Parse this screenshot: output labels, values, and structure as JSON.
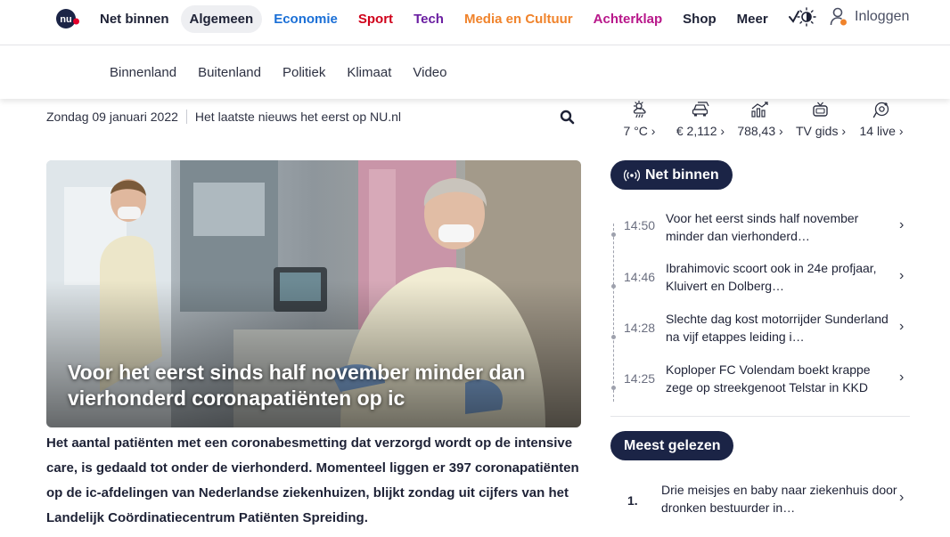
{
  "header": {
    "logo_alt": "NU.nl",
    "nav": [
      {
        "label": "Net binnen",
        "color": "#1e2236",
        "active": false
      },
      {
        "label": "Algemeen",
        "color": "#1e2236",
        "active": true
      },
      {
        "label": "Economie",
        "color": "#1a6fd6",
        "active": false
      },
      {
        "label": "Sport",
        "color": "#d0021b",
        "active": false
      },
      {
        "label": "Tech",
        "color": "#6a1ea1",
        "active": false
      },
      {
        "label": "Media en Cultuur",
        "color": "#f0832b",
        "active": false
      },
      {
        "label": "Achterklap",
        "color": "#b8178a",
        "active": false
      },
      {
        "label": "Shop",
        "color": "#1e2236",
        "active": false
      },
      {
        "label": "Meer",
        "color": "#1e2236",
        "active": false
      }
    ],
    "login_label": "Inloggen"
  },
  "subnav": [
    "Binnenland",
    "Buitenland",
    "Politiek",
    "Klimaat",
    "Video"
  ],
  "dateline": {
    "date": "Zondag 09 januari 2022",
    "tagline": "Het laatste nieuws het eerst op NU.nl"
  },
  "widgets": [
    {
      "icon": "weather-icon",
      "value": "7 °C ›"
    },
    {
      "icon": "fuel-price-icon",
      "value": "€ 2,112 ›"
    },
    {
      "icon": "stock-chart-icon",
      "value": "788,43 ›"
    },
    {
      "icon": "tv-icon",
      "value": "TV gids ›"
    },
    {
      "icon": "live-icon",
      "value": "14 live ›"
    }
  ],
  "hero": {
    "title": "Voor het eerst sinds half november minder dan vierhonderd coronapatiënten op ic",
    "intro": "Het aantal patiënten met een coronabesmetting dat verzorgd wordt op de intensive care, is gedaald tot onder de vierhonderd. Momenteel liggen er 397 coronapatiënten op de ic-afdelingen van Nederlandse ziekenhuizen, blijkt zondag uit cijfers van het Landelijk Coördinatiecentrum Patiënten Spreiding."
  },
  "net_binnen": {
    "label": "Net binnen",
    "items": [
      {
        "time": "14:50",
        "text": "Voor het eerst sinds half november minder dan vierhonderd…"
      },
      {
        "time": "14:46",
        "text": "Ibrahimovic scoort ook in 24e profjaar, Kluivert en Dolberg…"
      },
      {
        "time": "14:28",
        "text": "Slechte dag kost motorrijder Sunderland na vijf etappes leiding i…"
      },
      {
        "time": "14:25",
        "text": "Koploper FC Volendam boekt krappe zege op streekgenoot Telstar in KKD"
      }
    ]
  },
  "meest_gelezen": {
    "label": "Meest gelezen",
    "items": [
      {
        "rank": "1.",
        "text": "Drie meisjes en baby naar ziekenhuis door dronken bestuurder in…"
      }
    ]
  }
}
